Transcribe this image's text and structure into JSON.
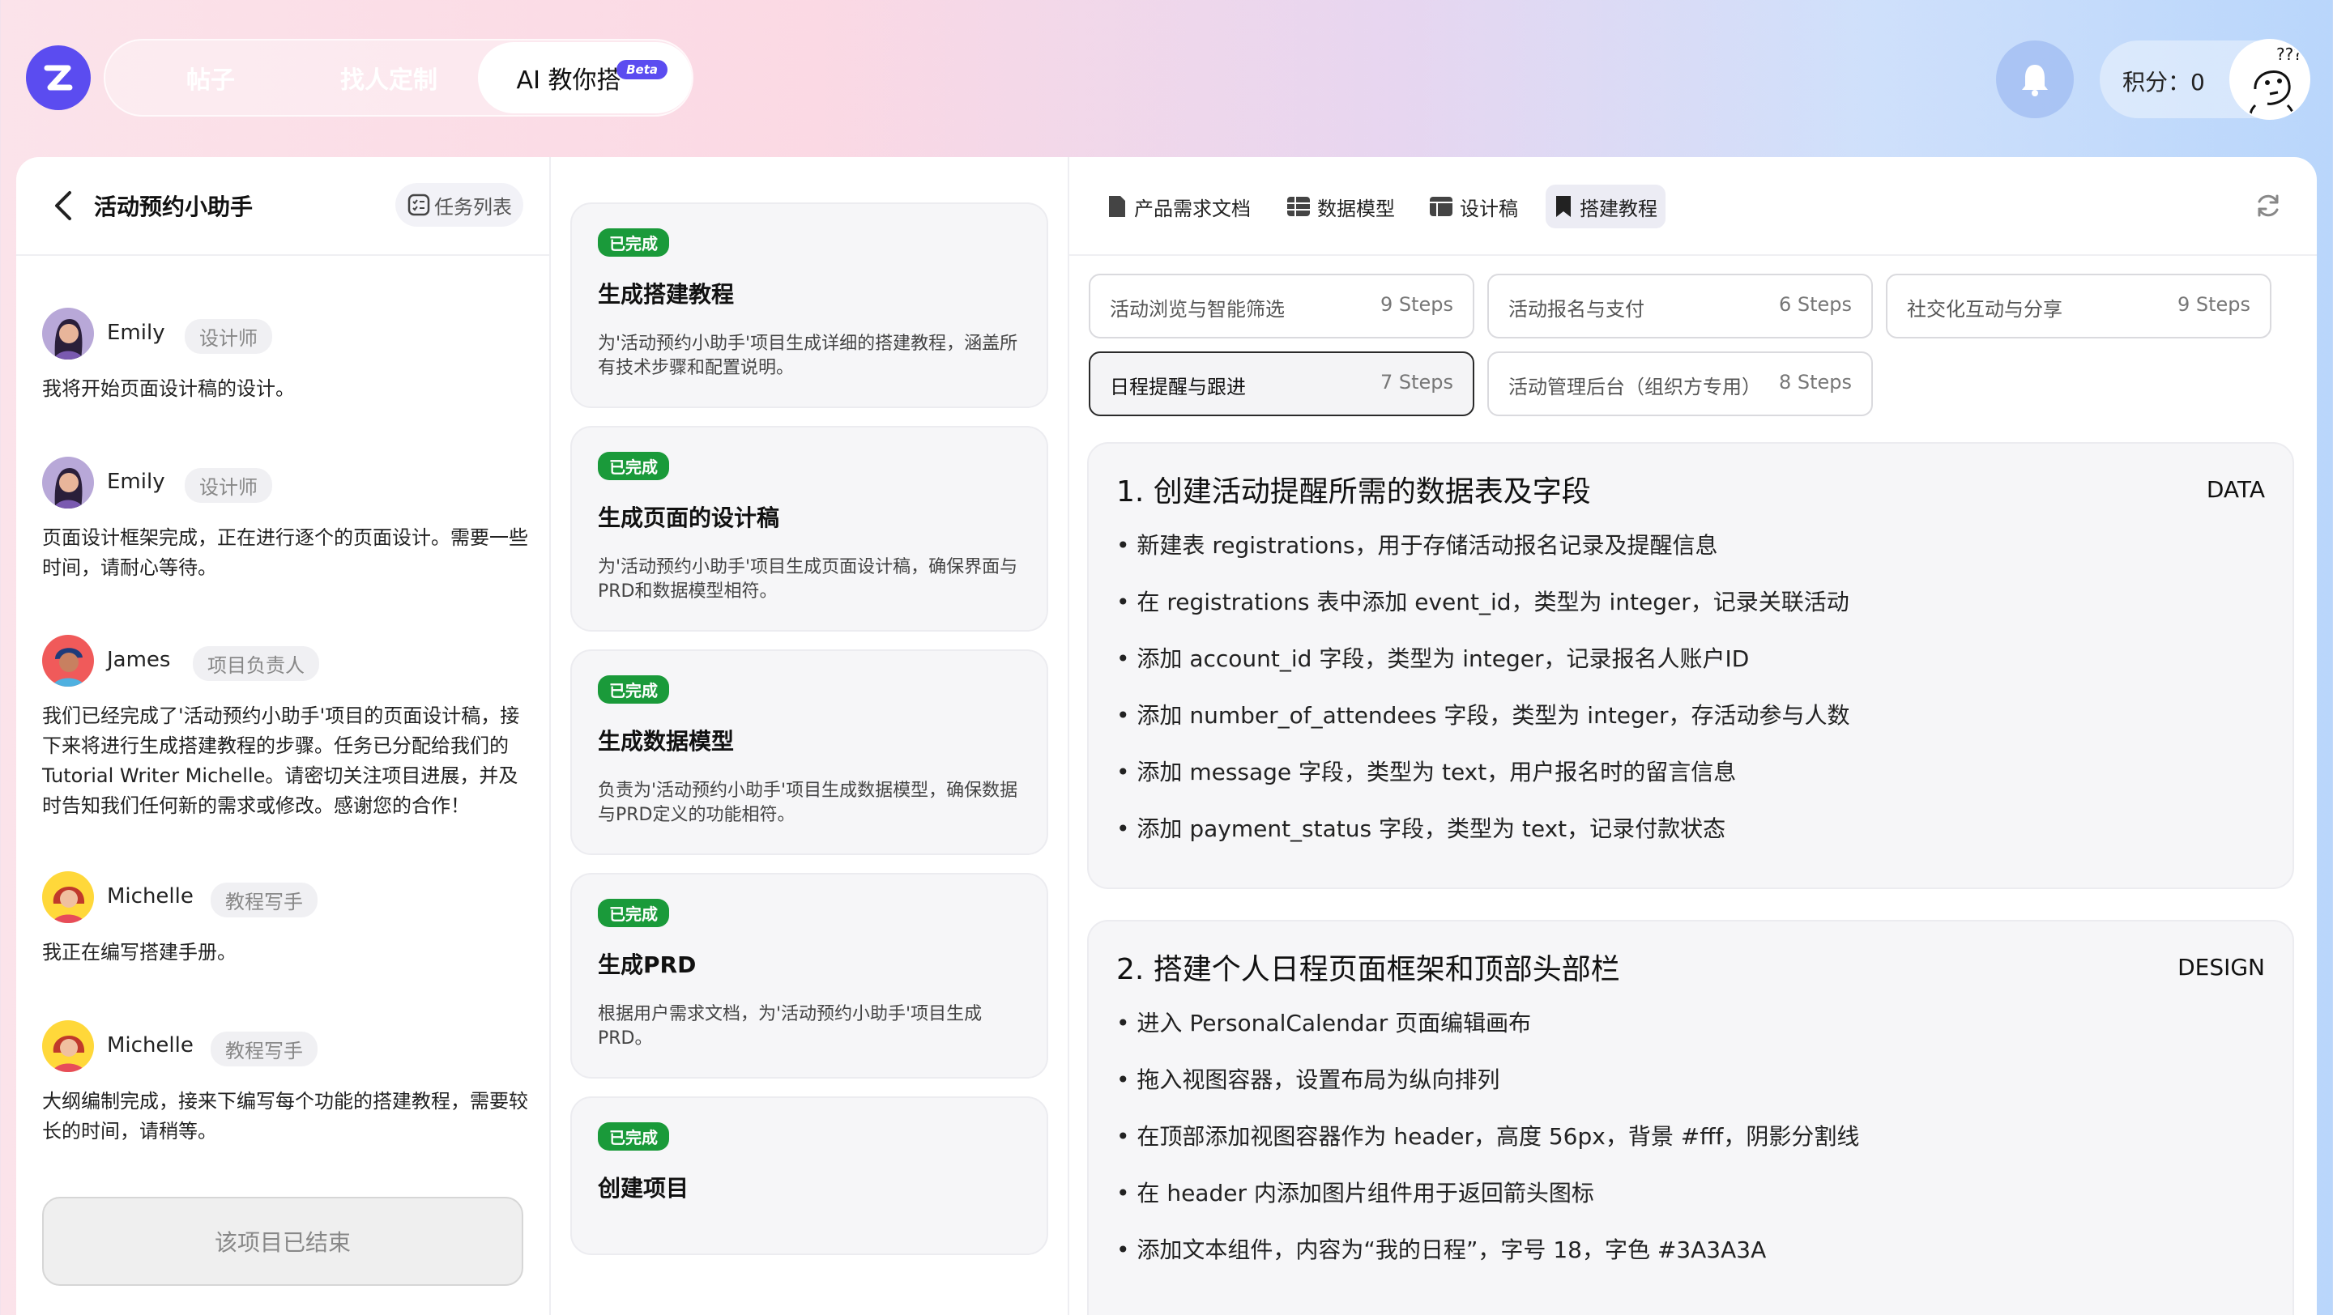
{
  "nav": {
    "tabs": [
      {
        "label": "帖子"
      },
      {
        "label": "找人定制"
      },
      {
        "label": "AI 教你搭",
        "badge": "Beta"
      }
    ]
  },
  "header": {
    "points_label": "积分：0"
  },
  "left": {
    "title": "活动预约小助手",
    "task_list_label": "任务列表",
    "messages": [
      {
        "name": "Emily",
        "role": "设计师",
        "text": "我将开始页面设计稿的设计。"
      },
      {
        "name": "Emily",
        "role": "设计师",
        "text": "页面设计框架完成，正在进行逐个的页面设计。需要一些时间，请耐心等待。"
      },
      {
        "name": "James",
        "role": "项目负责人",
        "text": "我们已经完成了'活动预约小助手'项目的页面设计稿，接下来将进行生成搭建教程的步骤。任务已分配给我们的Tutorial Writer Michelle。请密切关注项目进展，并及时告知我们任何新的需求或修改。感谢您的合作！"
      },
      {
        "name": "Michelle",
        "role": "教程写手",
        "text": "我正在编写搭建手册。"
      },
      {
        "name": "Michelle",
        "role": "教程写手",
        "text": "大纲编制完成，接来下编写每个功能的搭建教程，需要较长的时间，请稍等。"
      }
    ],
    "ended_label": "该项目已结束"
  },
  "middle": {
    "cards": [
      {
        "status": "已完成",
        "title": "生成搭建教程",
        "desc": "为'活动预约小助手'项目生成详细的搭建教程，涵盖所有技术步骤和配置说明。"
      },
      {
        "status": "已完成",
        "title": "生成页面的设计稿",
        "desc": "为'活动预约小助手'项目生成页面设计稿，确保界面与PRD和数据模型相符。"
      },
      {
        "status": "已完成",
        "title": "生成数据模型",
        "desc": "负责为'活动预约小助手'项目生成数据模型，确保数据与PRD定义的功能相符。"
      },
      {
        "status": "已完成",
        "title": "生成PRD",
        "desc": "根据用户需求文档，为'活动预约小助手'项目生成PRD。"
      },
      {
        "status": "已完成",
        "title": "创建项目",
        "desc": ""
      }
    ]
  },
  "right": {
    "tabs": [
      {
        "label": "产品需求文档",
        "icon": "document-icon"
      },
      {
        "label": "数据模型",
        "icon": "table-icon"
      },
      {
        "label": "设计稿",
        "icon": "layout-icon"
      },
      {
        "label": "搭建教程",
        "icon": "bookmark-icon"
      }
    ],
    "steps": [
      {
        "label": "活动浏览与智能筛选",
        "count": "9 Steps"
      },
      {
        "label": "活动报名与支付",
        "count": "6 Steps"
      },
      {
        "label": "社交化互动与分享",
        "count": "9 Steps"
      },
      {
        "label": "日程提醒与跟进",
        "count": "7 Steps"
      },
      {
        "label": "活动管理后台（组织方专用）",
        "count": "8 Steps"
      }
    ],
    "sections": [
      {
        "title": "1. 创建活动提醒所需的数据表及字段",
        "tag": "DATA",
        "items": [
          "新建表 registrations，用于存储活动报名记录及提醒信息",
          "在 registrations 表中添加 event_id，类型为 integer，记录关联活动",
          "添加 account_id 字段，类型为 integer，记录报名人账户ID",
          "添加 number_of_attendees 字段，类型为 integer，存活动参与人数",
          "添加 message 字段，类型为 text，用户报名时的留言信息",
          "添加 payment_status 字段，类型为 text，记录付款状态"
        ]
      },
      {
        "title": "2. 搭建个人日程页面框架和顶部头部栏",
        "tag": "DESIGN",
        "items": [
          "进入 PersonalCalendar 页面编辑画布",
          "拖入视图容器，设置布局为纵向排列",
          "在顶部添加视图容器作为 header，高度 56px，背景 #fff，阴影分割线",
          "在 header 内添加图片组件用于返回箭头图标",
          "添加文本组件，内容为“我的日程”，字号 18，字色 #3A3A3A"
        ]
      }
    ]
  },
  "colors": {
    "brand": "#5b4cf0",
    "done": "#1a9a3a"
  }
}
